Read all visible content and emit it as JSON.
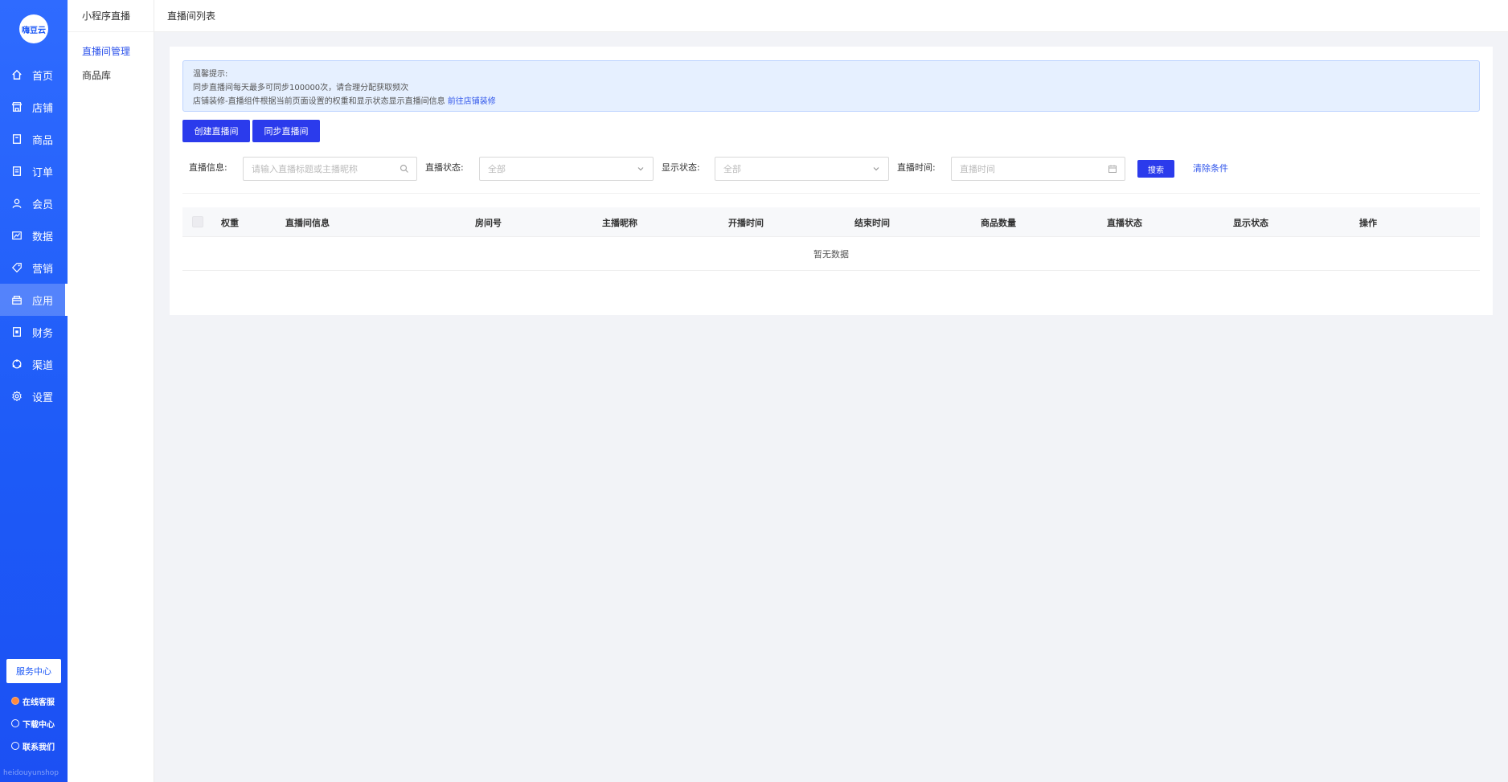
{
  "brand": {
    "logo_text": "嗨豆云",
    "watermark": "heidouyunshop"
  },
  "nav": {
    "items": [
      {
        "label": "首页",
        "icon": "home-icon"
      },
      {
        "label": "店铺",
        "icon": "store-icon"
      },
      {
        "label": "商品",
        "icon": "goods-icon"
      },
      {
        "label": "订单",
        "icon": "order-icon"
      },
      {
        "label": "会员",
        "icon": "member-icon"
      },
      {
        "label": "数据",
        "icon": "chart-icon"
      },
      {
        "label": "营销",
        "icon": "tag-icon"
      },
      {
        "label": "应用",
        "icon": "app-icon",
        "active": true
      },
      {
        "label": "财务",
        "icon": "finance-icon"
      },
      {
        "label": "渠道",
        "icon": "channel-icon"
      },
      {
        "label": "设置",
        "icon": "gear-icon"
      }
    ],
    "service_center": "服务中心",
    "bottom_links": [
      {
        "label": "在线客服",
        "icon": "chat-icon"
      },
      {
        "label": "下载中心",
        "icon": "download-icon"
      },
      {
        "label": "联系我们",
        "icon": "contact-icon"
      }
    ]
  },
  "subnav": {
    "title": "小程序直播",
    "items": [
      {
        "label": "直播间管理",
        "active": true
      },
      {
        "label": "商品库"
      }
    ]
  },
  "header": {
    "breadcrumb": "直播间列表"
  },
  "tip": {
    "title": "温馨提示:",
    "line1": "同步直播间每天最多可同步100000次，请合理分配获取频次",
    "line2": "店铺装修-直播组件根据当前页面设置的权重和显示状态显示直播间信息",
    "link": "前往店铺装修"
  },
  "actions": {
    "create": "创建直播间",
    "sync": "同步直播间"
  },
  "filters": {
    "info_label": "直播信息:",
    "info_placeholder": "请输入直播标题或主播昵称",
    "live_status_label": "直播状态:",
    "live_status_value": "全部",
    "display_status_label": "显示状态:",
    "display_status_value": "全部",
    "time_label": "直播时间:",
    "time_placeholder": "直播时间",
    "search": "搜索",
    "clear": "清除条件"
  },
  "table": {
    "columns": [
      "权重",
      "直播间信息",
      "房间号",
      "主播昵称",
      "开播时间",
      "结束时间",
      "商品数量",
      "直播状态",
      "显示状态",
      "操作"
    ],
    "empty_text": "暂无数据"
  },
  "colors": {
    "primary": "#2b3bec",
    "nav_bg": "#1d5af7",
    "link": "#2f55eb"
  }
}
